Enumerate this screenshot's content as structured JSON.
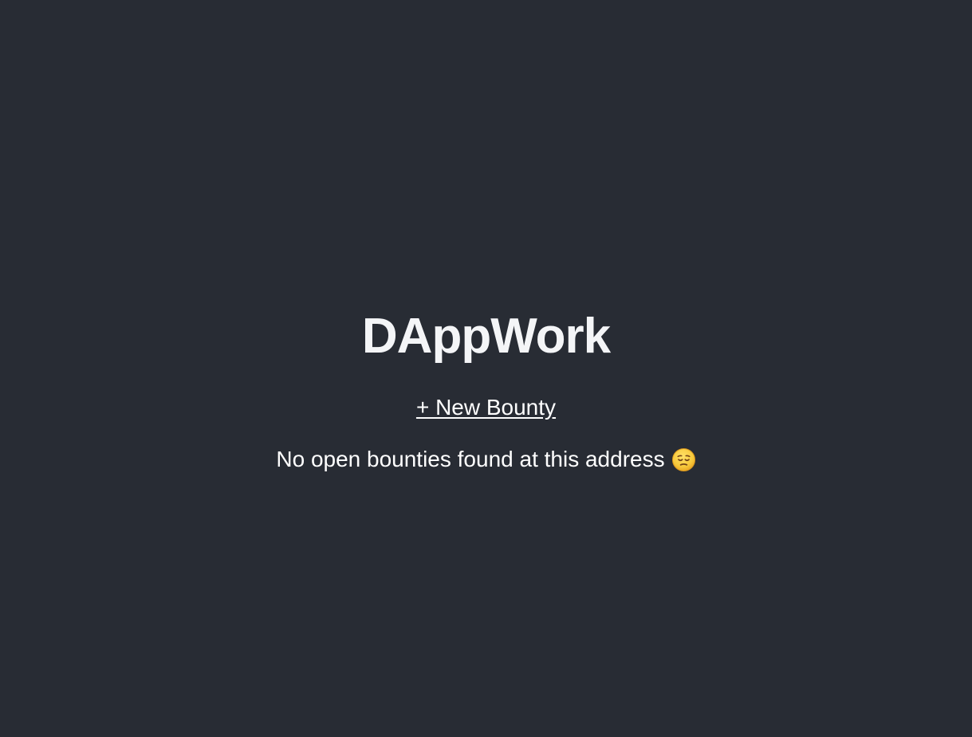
{
  "app": {
    "title": "DAppWork"
  },
  "actions": {
    "new_bounty_label": "+ New Bounty"
  },
  "status": {
    "empty_message": "No open bounties found at this address",
    "emoji": "pensive-face-icon"
  },
  "colors": {
    "background": "#282c34",
    "text": "#f4f5f7",
    "emoji_face": "#f7c93b"
  }
}
